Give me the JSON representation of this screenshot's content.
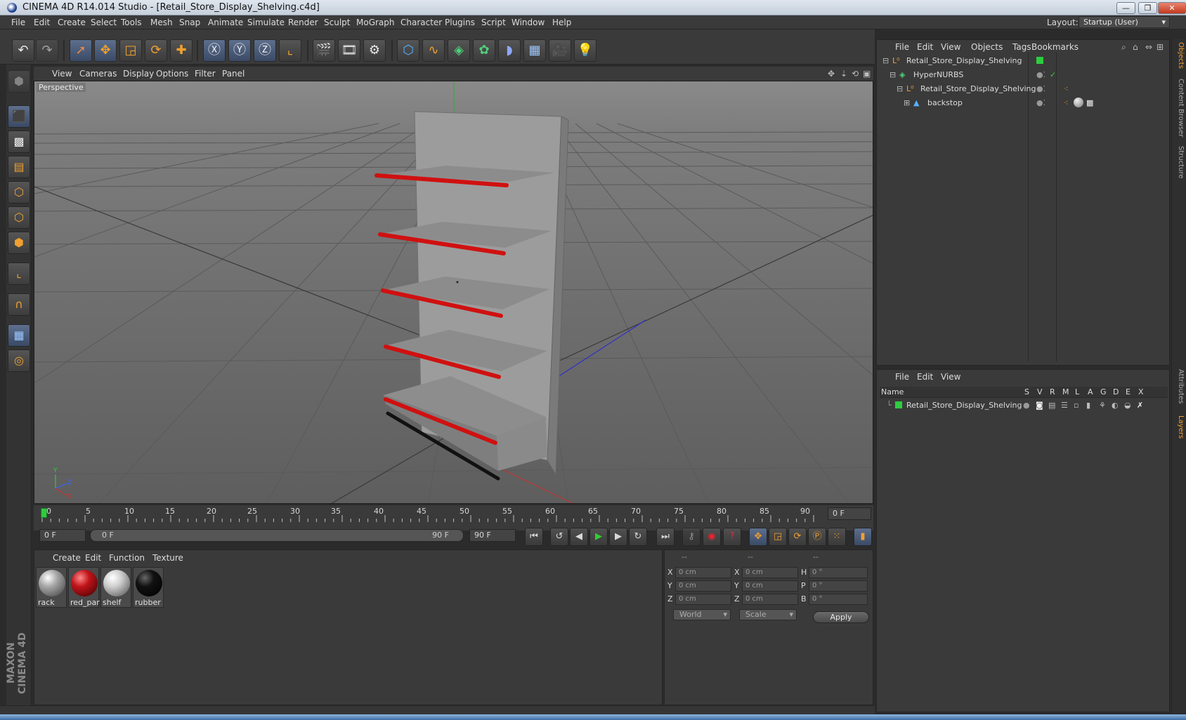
{
  "window": {
    "title": "CINEMA 4D R14.014 Studio - [Retail_Store_Display_Shelving.c4d]",
    "controls": [
      "—",
      "❐",
      "✕"
    ]
  },
  "menubar": {
    "items": [
      "File",
      "Edit",
      "Create",
      "Select",
      "Tools",
      "Mesh",
      "Snap",
      "Animate",
      "Simulate",
      "Render",
      "Sculpt",
      "MoGraph",
      "Character",
      "Plugins",
      "Script",
      "Window",
      "Help"
    ],
    "layout_label": "Layout:",
    "layout_value": "Startup (User)"
  },
  "viewport": {
    "menu": [
      "View",
      "Cameras",
      "Display",
      "Options",
      "Filter",
      "Panel"
    ],
    "label": "Perspective",
    "axis_labels": [
      "Y",
      "Z",
      "X"
    ]
  },
  "timeline": {
    "ticks": [
      "0",
      "5",
      "10",
      "15",
      "20",
      "25",
      "30",
      "35",
      "40",
      "45",
      "50",
      "55",
      "60",
      "65",
      "70",
      "75",
      "80",
      "85",
      "90"
    ],
    "current_frame": "0 F",
    "start_field": "0 F",
    "range_start": "0 F",
    "range_end": "90 F",
    "end_field": "90 F"
  },
  "materials": {
    "menu": [
      "Create",
      "Edit",
      "Function",
      "Texture"
    ],
    "items": [
      {
        "name": "rack",
        "color": "#a8a8a8"
      },
      {
        "name": "red_part",
        "color": "#c0141a"
      },
      {
        "name": "shelf",
        "color": "#cfcfcf"
      },
      {
        "name": "rubber",
        "color": "#111111"
      }
    ]
  },
  "coordinates": {
    "headers": [
      "--",
      "--",
      "--"
    ],
    "rows": [
      {
        "pos_label": "X",
        "pos_value": "0 cm",
        "size_label": "X",
        "size_value": "0 cm",
        "rot_label": "H",
        "rot_value": "0 °"
      },
      {
        "pos_label": "Y",
        "pos_value": "0 cm",
        "size_label": "Y",
        "size_value": "0 cm",
        "rot_label": "P",
        "rot_value": "0 °"
      },
      {
        "pos_label": "Z",
        "pos_value": "0 cm",
        "size_label": "Z",
        "size_value": "0 cm",
        "rot_label": "B",
        "rot_value": "0 °"
      }
    ],
    "mode_select": "World",
    "scale_select": "Scale",
    "apply_label": "Apply"
  },
  "object_manager": {
    "menu": [
      "File",
      "Edit",
      "View",
      "Objects",
      "Tags",
      "Bookmarks"
    ],
    "objects": [
      {
        "name": "Retail_Store_Display_Shelving"
      },
      {
        "name": "HyperNURBS"
      },
      {
        "name": "Retail_Store_Display_Shelving"
      },
      {
        "name": "backstop"
      }
    ]
  },
  "layer_manager": {
    "menu": [
      "File",
      "Edit",
      "View"
    ],
    "columns": [
      "Name",
      "S",
      "V",
      "R",
      "M",
      "L",
      "A",
      "G",
      "D",
      "E",
      "X"
    ],
    "layers": [
      {
        "name": "Retail_Store_Display_Shelving",
        "color": "#2ecc40"
      }
    ]
  },
  "side_tabs": [
    "Objects",
    "Content Browser",
    "Structure",
    "Attributes",
    "Layers"
  ],
  "logo": {
    "text": "MAXON CINEMA 4D"
  },
  "colors": {
    "accent_selection": "#5d6f8d",
    "shelf_red": "#d01010",
    "viewport_bg": "#7a7a7a"
  }
}
